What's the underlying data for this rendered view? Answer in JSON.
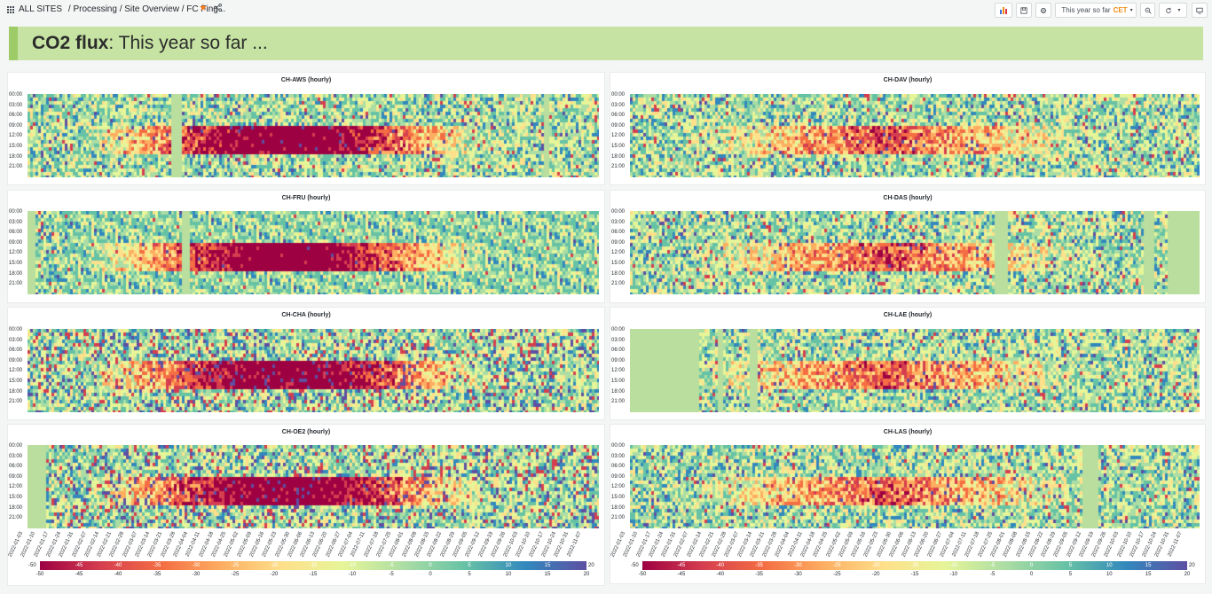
{
  "breadcrumb": {
    "home": "ALL SITES",
    "path": "/ Processing / Site Overview / FC Fing..."
  },
  "toolbar": {
    "time_range": "This year so far",
    "timezone": "CET"
  },
  "banner": {
    "title_bold": "CO2 flux",
    "title_rest": ": This year so far ..."
  },
  "y_ticks": [
    "00:00",
    "03:00",
    "06:00",
    "09:00",
    "12:00",
    "15:00",
    "18:00",
    "21:00"
  ],
  "panels": [
    {
      "title": "CH-AWS (hourly)"
    },
    {
      "title": "CH-DAV (hourly)"
    },
    {
      "title": "CH-FRU (hourly)"
    },
    {
      "title": "CH-DAS (hourly)"
    },
    {
      "title": "CH-CHA (hourly)"
    },
    {
      "title": "CH-LAE (hourly)"
    },
    {
      "title": "CH-OE2 (hourly)"
    },
    {
      "title": "CH-LAS (hourly)"
    }
  ],
  "x_ticks": [
    "2022-01-03",
    "2022-01-10",
    "2022-01-17",
    "2022-01-24",
    "2022-01-31",
    "2022-02-07",
    "2022-02-14",
    "2022-02-21",
    "2022-02-28",
    "2022-03-07",
    "2022-03-14",
    "2022-03-21",
    "2022-03-28",
    "2022-04-04",
    "2022-04-11",
    "2022-04-18",
    "2022-04-25",
    "2022-05-02",
    "2022-05-09",
    "2022-05-16",
    "2022-05-23",
    "2022-05-30",
    "2022-06-06",
    "2022-06-13",
    "2022-06-20",
    "2022-06-27",
    "2022-07-04",
    "2022-07-11",
    "2022-07-18",
    "2022-07-25",
    "2022-08-01",
    "2022-08-08",
    "2022-08-15",
    "2022-08-22",
    "2022-08-29",
    "2022-09-05",
    "2022-09-12",
    "2022-09-19",
    "2022-09-26",
    "2022-10-03",
    "2022-10-10",
    "2022-10-17",
    "2022-10-24",
    "2022-10-31",
    "2022-11-07"
  ],
  "colorbar": {
    "min_label": "-50",
    "max_label": "20",
    "ticks": [
      "-50",
      "-45",
      "-40",
      "-35",
      "-30",
      "-25",
      "-20",
      "-15",
      "-10",
      "-5",
      "0",
      "5",
      "10",
      "15",
      "20"
    ],
    "inner": [
      "-45",
      "-40",
      "-35",
      "-30",
      "-25",
      "-20",
      "-15",
      "-10",
      "-5",
      "0",
      "5",
      "10",
      "15"
    ]
  },
  "colors": {
    "banner_bg": "#c6e3a3",
    "banner_accent": "#9ccb68",
    "scale": [
      "#9e0142",
      "#d53e4f",
      "#f46d43",
      "#fdae61",
      "#fee08b",
      "#e6f598",
      "#abdda4",
      "#66c2a5",
      "#3288bd",
      "#5e4fa2"
    ]
  }
}
